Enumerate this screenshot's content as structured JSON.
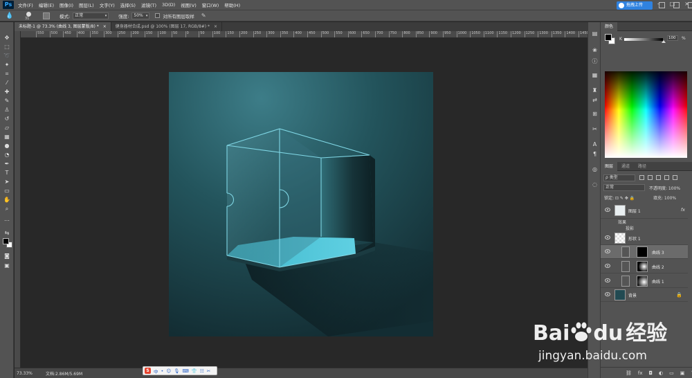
{
  "app": {
    "logo": "Ps",
    "menu": [
      "文件(F)",
      "编辑(E)",
      "图像(I)",
      "图层(L)",
      "文字(Y)",
      "选择(S)",
      "滤镜(T)",
      "3D(D)",
      "视图(V)",
      "窗口(W)",
      "帮助(H)"
    ],
    "window_controls": [
      "–",
      "□",
      "×"
    ]
  },
  "options": {
    "brush_size": "31",
    "mode_label": "模式:",
    "mode_value": "正常",
    "flow_label": "强度:",
    "flow_value": "50%",
    "sample_all_label": "对所有图层取样",
    "cloud_button": "拖拽上传"
  },
  "tabs": [
    {
      "label": "未标题-1 @ 73.3% (曲线 3, 图层蒙版/8) *",
      "close": "×",
      "active": true
    },
    {
      "label": "健身器材合成.psd @ 100% (图层 17, RGB/8#) *",
      "close": "×",
      "active": false
    }
  ],
  "ruler": {
    "h_ticks": [
      "550",
      "500",
      "450",
      "400",
      "350",
      "300",
      "250",
      "200",
      "150",
      "100",
      "50",
      "0",
      "50",
      "100",
      "150",
      "200",
      "250",
      "300",
      "350",
      "400",
      "450",
      "500",
      "550",
      "600",
      "650",
      "700",
      "750",
      "800",
      "850",
      "900",
      "950",
      "1000",
      "1050",
      "1100",
      "1150",
      "1200",
      "1250",
      "1300",
      "1350",
      "1400",
      "1450",
      "1500",
      "1550"
    ]
  },
  "status": {
    "zoom": "73.33%",
    "doc_info": "文档:2.86M/5.69M"
  },
  "ime": {
    "logo": "S",
    "items": [
      "中",
      "•",
      "☺",
      "🎙",
      "⌨",
      "👕",
      "☷",
      "✂"
    ]
  },
  "color_panel": {
    "title": "颜色",
    "channel_label": "K",
    "channel_value": "100",
    "percent": "%"
  },
  "layers_panel": {
    "tabs": [
      "图层",
      "通道",
      "路径"
    ],
    "filter_kind": "ρ 类型",
    "blend_mode": "正常",
    "opacity_label": "不透明度: 100%",
    "lock_label": "锁定: ⊡ ✎ ✥ 🔒",
    "fill_label": "填充: 100%",
    "layers": [
      {
        "name": "图层 1",
        "fx": "fx",
        "effects_label": "效果",
        "effect": "投影"
      },
      {
        "name": "形状 1"
      },
      {
        "name": "曲线 3",
        "selected": true
      },
      {
        "name": "曲线 2"
      },
      {
        "name": "曲线 1"
      },
      {
        "name": "背景",
        "locked": true
      }
    ],
    "footer_icons": [
      "⛓",
      "fx",
      "◘",
      "◐",
      "▭",
      "▣",
      "🗑"
    ]
  },
  "watermark": {
    "brand": "Bai",
    "brand_tail": "du",
    "brand_cn": "经验",
    "url": "jingyan.baidu.com"
  },
  "colors": {
    "canvas_bg": "#204a52",
    "glass_edge": "#7fd6e4",
    "floor_glow": "#4cc6da"
  }
}
